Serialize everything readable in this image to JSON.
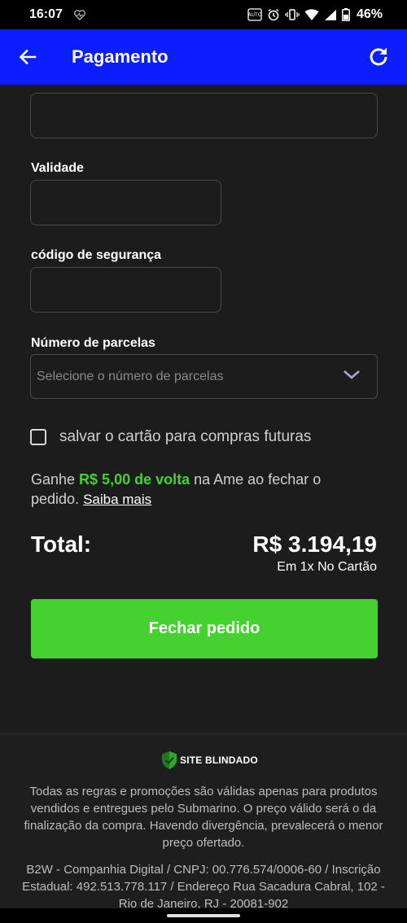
{
  "status_bar": {
    "time": "16:07",
    "battery": "46%",
    "icons": [
      "heart-pulse-icon",
      "auto-icon",
      "alarm-icon",
      "vibrate-icon",
      "wifi-icon",
      "signal-icon",
      "battery-icon"
    ]
  },
  "app_bar": {
    "title": "Pagamento",
    "back_icon": "arrow-left-icon",
    "refresh_icon": "refresh-icon",
    "color": "#0a1eff"
  },
  "form": {
    "cut_label": "",
    "validity_label": "Validade",
    "validity_value": "",
    "security_label": "código de segurança",
    "security_value": "",
    "installments_label": "Número de parcelas",
    "installments_placeholder": "Selecione o número de parcelas",
    "save_card_label": "salvar o cartão para compras futuras",
    "save_card_checked": false
  },
  "cashback": {
    "prefix": "Ganhe ",
    "amount": "R$ 5,00 de volta",
    "suffix": " na Ame ao fechar o pedido. ",
    "link": "Saiba mais",
    "color": "#45d130"
  },
  "total": {
    "label": "Total:",
    "value": "R$ 3.194,19",
    "installments": "Em 1x No Cartão"
  },
  "cta": {
    "label": "Fechar pedido",
    "color": "#45d130"
  },
  "footer": {
    "seal_text": "SITE BLINDADO",
    "rules_text": "Todas as regras e promoções são válidas apenas para produtos vendidos e entregues pelo Submarino. O preço válido será o da finalização da compra. Havendo divergência, prevalecerá o menor preço ofertado.",
    "company_text": "B2W - Companhia Digital / CNPJ: 00.776.574/0006-60 / Inscrição Estadual: 492.513.778.117 / Endereço Rua Sacadura Cabral, 102 - Rio de Janeiro, RJ - 20081-902"
  }
}
